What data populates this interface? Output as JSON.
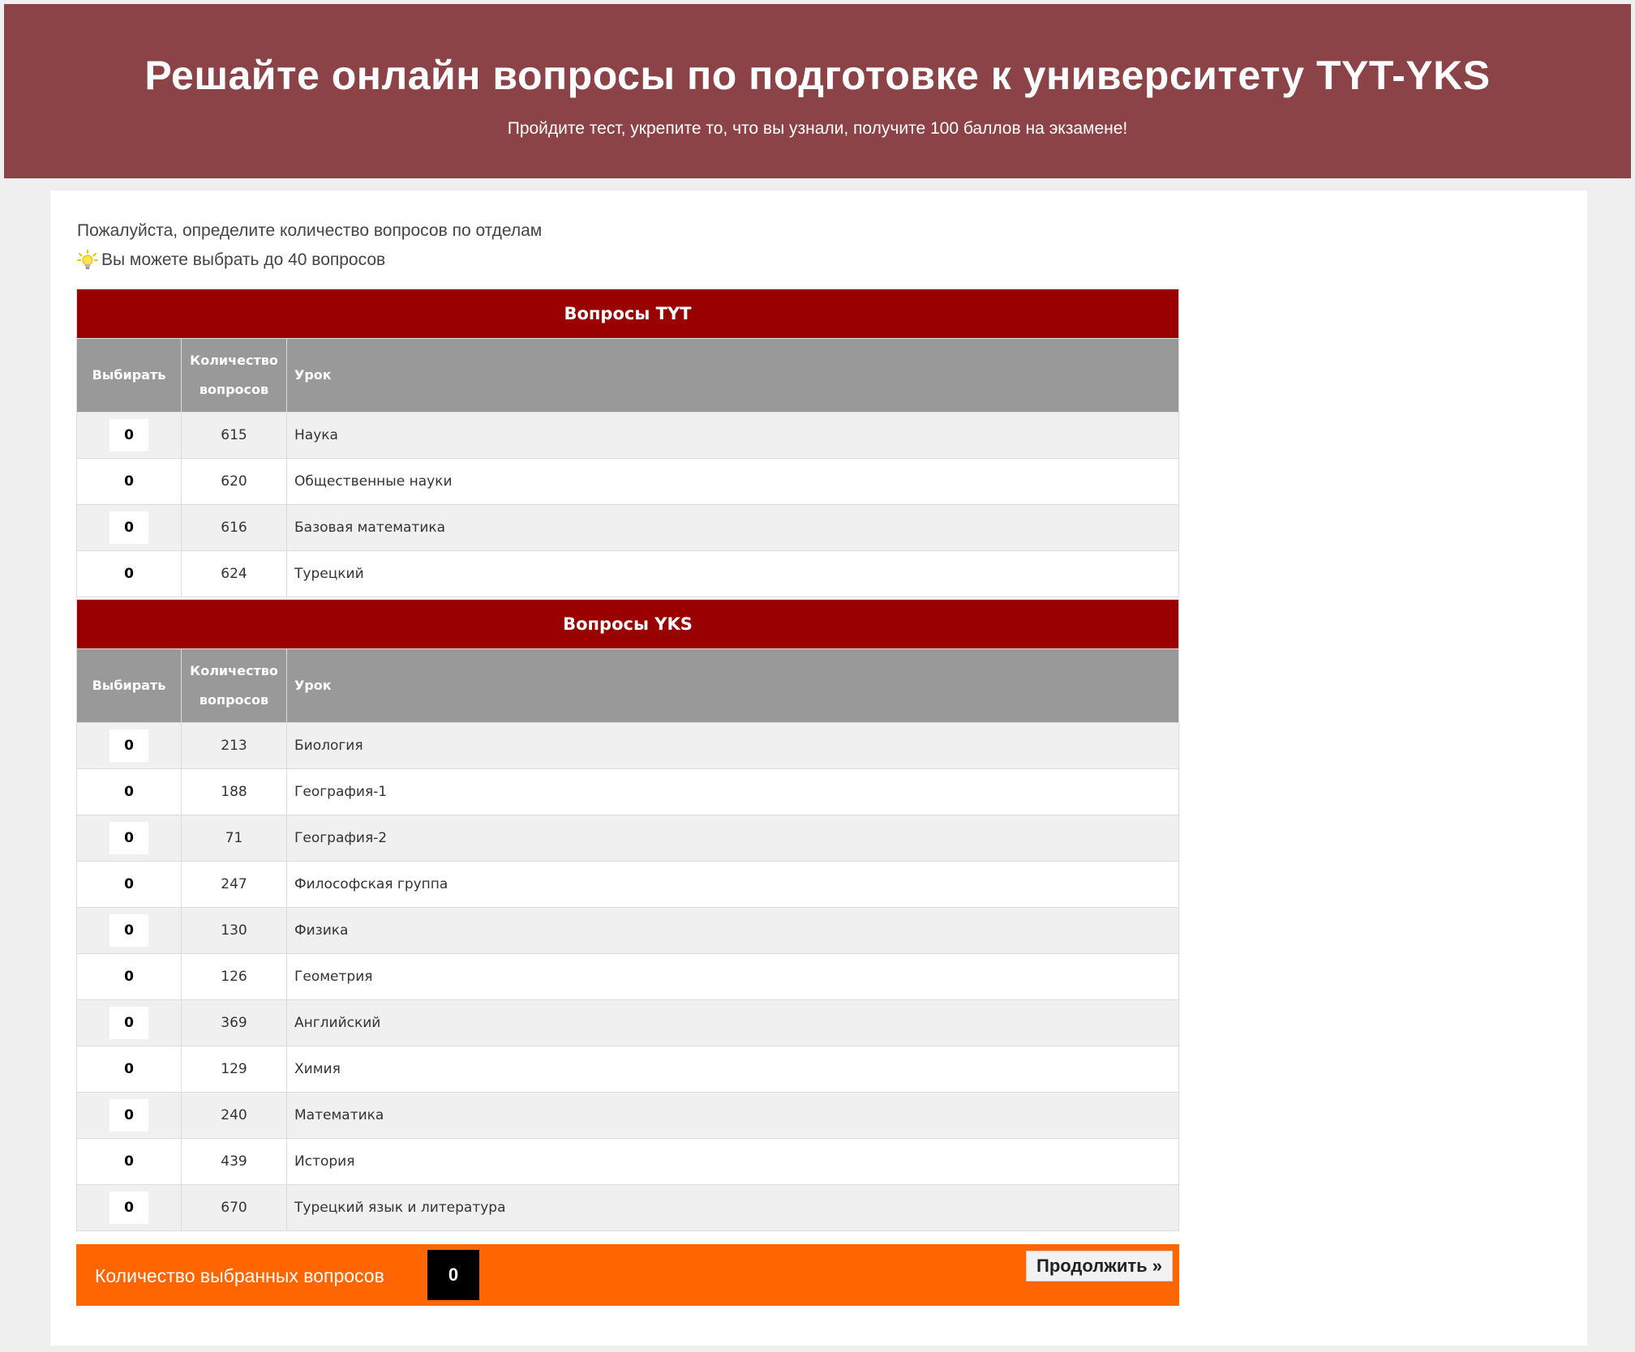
{
  "header": {
    "title": "Решайте онлайн вопросы по подготовке к университету TYT-YKS",
    "subtitle": "Пройдите тест, укрепите то, что вы узнали, получите 100 баллов на экзамене!"
  },
  "intro": {
    "instruction": "Пожалуйста, определите количество вопросов по отделам",
    "tip_icon": "lightbulb-icon",
    "tip": "Вы можете выбрать до 40 вопросов"
  },
  "columns": {
    "select": "Выбирать",
    "count_line1": "Количество",
    "count_line2": "вопросов",
    "lesson": "Урок"
  },
  "tyt": {
    "title": "Вопросы TYT",
    "rows": [
      {
        "selected": "0",
        "count": "615",
        "lesson": "Наука"
      },
      {
        "selected": "0",
        "count": "620",
        "lesson": "Общественные науки"
      },
      {
        "selected": "0",
        "count": "616",
        "lesson": "Базовая математика"
      },
      {
        "selected": "0",
        "count": "624",
        "lesson": "Турецкий"
      }
    ]
  },
  "yks": {
    "title": "Вопросы YKS",
    "rows": [
      {
        "selected": "0",
        "count": "213",
        "lesson": "Биология"
      },
      {
        "selected": "0",
        "count": "188",
        "lesson": "География-1"
      },
      {
        "selected": "0",
        "count": "71",
        "lesson": "География-2"
      },
      {
        "selected": "0",
        "count": "247",
        "lesson": "Философская группа"
      },
      {
        "selected": "0",
        "count": "130",
        "lesson": "Физика"
      },
      {
        "selected": "0",
        "count": "126",
        "lesson": "Геометрия"
      },
      {
        "selected": "0",
        "count": "369",
        "lesson": "Английский"
      },
      {
        "selected": "0",
        "count": "129",
        "lesson": "Химия"
      },
      {
        "selected": "0",
        "count": "240",
        "lesson": "Математика"
      },
      {
        "selected": "0",
        "count": "439",
        "lesson": "История"
      },
      {
        "selected": "0",
        "count": "670",
        "lesson": "Турецкий язык и литература"
      }
    ]
  },
  "footer": {
    "selected_label": "Количество выбранных вопросов",
    "selected_count": "0",
    "continue_label": "Продолжить »"
  },
  "colors": {
    "header_bg": "#8b4347",
    "section_bg": "#990000",
    "column_header_bg": "#999999",
    "footer_bg": "#ff6600"
  }
}
